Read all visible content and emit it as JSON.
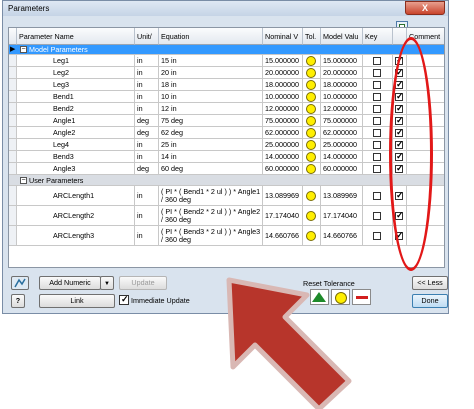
{
  "window": {
    "title": "Parameters",
    "close_glyph": "X"
  },
  "columns": {
    "name": "Parameter Name",
    "unit": "Unit/",
    "equation": "Equation",
    "nominal": "Nominal V",
    "tol": "Tol.",
    "model": "Model Valu",
    "key": "Key",
    "comment": "Comment"
  },
  "groups": {
    "model": "Model Parameters",
    "user": "User Parameters"
  },
  "model_params": [
    {
      "name": "Leg1",
      "unit": "in",
      "eq": "15 in",
      "nom": "15.000000",
      "model": "15.000000",
      "exported": true
    },
    {
      "name": "Leg2",
      "unit": "in",
      "eq": "20 in",
      "nom": "20.000000",
      "model": "20.000000",
      "exported": true
    },
    {
      "name": "Leg3",
      "unit": "in",
      "eq": "18 in",
      "nom": "18.000000",
      "model": "18.000000",
      "exported": true
    },
    {
      "name": "Bend1",
      "unit": "in",
      "eq": "10 in",
      "nom": "10.000000",
      "model": "10.000000",
      "exported": true
    },
    {
      "name": "Bend2",
      "unit": "in",
      "eq": "12 in",
      "nom": "12.000000",
      "model": "12.000000",
      "exported": true
    },
    {
      "name": "Angle1",
      "unit": "deg",
      "eq": "75 deg",
      "nom": "75.000000",
      "model": "75.000000",
      "exported": true
    },
    {
      "name": "Angle2",
      "unit": "deg",
      "eq": "62 deg",
      "nom": "62.000000",
      "model": "62.000000",
      "exported": true
    },
    {
      "name": "Leg4",
      "unit": "in",
      "eq": "25 in",
      "nom": "25.000000",
      "model": "25.000000",
      "exported": true
    },
    {
      "name": "Bend3",
      "unit": "in",
      "eq": "14 in",
      "nom": "14.000000",
      "model": "14.000000",
      "exported": true
    },
    {
      "name": "Angle3",
      "unit": "deg",
      "eq": "60 deg",
      "nom": "60.000000",
      "model": "60.000000",
      "exported": true
    }
  ],
  "user_params": [
    {
      "name": "ARCLength1",
      "unit": "in",
      "eq": "( PI * ( Bend1 * 2 ul ) ) * Angle1 / 360 deg",
      "nom": "13.089969",
      "model": "13.089969",
      "exported": true
    },
    {
      "name": "ARCLength2",
      "unit": "in",
      "eq": "( PI * ( Bend2 * 2 ul ) ) * Angle2 / 360 deg",
      "nom": "17.174040",
      "model": "17.174040",
      "exported": true
    },
    {
      "name": "ARCLength3",
      "unit": "in",
      "eq": "( PI * ( Bend3 * 2 ul ) ) * Angle3 / 360 deg",
      "nom": "14.660766",
      "model": "14.660766",
      "exported": true
    }
  ],
  "footer": {
    "add_numeric": "Add Numeric",
    "update": "Update",
    "link": "Link",
    "immediate_update": "Immediate Update",
    "immediate_checked": true,
    "reset_tolerance": "Reset Tolerance",
    "less": "<< Less",
    "done": "Done",
    "help": "?"
  },
  "colors": {
    "highlight": "#e21818",
    "arrow_fill": "#b7352b",
    "arrow_edge": "#d9b8b4",
    "tolerance_dot": "#ffef00"
  }
}
